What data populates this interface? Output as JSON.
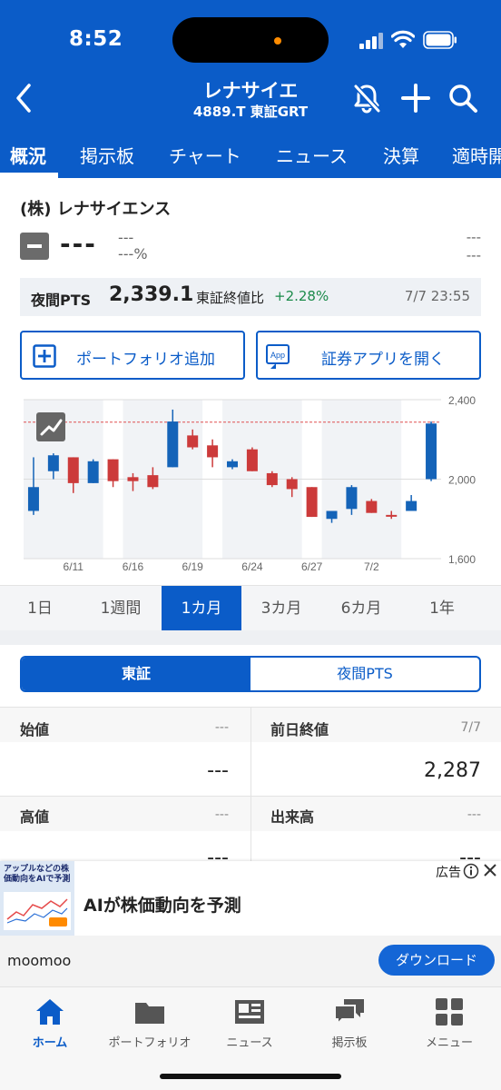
{
  "status_bar": {
    "time": "8:52"
  },
  "header": {
    "title": "レナサイエ",
    "subtitle": "4889.T 東証GRT",
    "icons": [
      "back-chevron-icon",
      "bell-off-icon",
      "plus-icon",
      "search-icon"
    ]
  },
  "tabs": [
    {
      "label": "概況",
      "active": true
    },
    {
      "label": "掲示板",
      "active": false
    },
    {
      "label": "チャート",
      "active": false
    },
    {
      "label": "ニュース",
      "active": false
    },
    {
      "label": "決算",
      "active": false
    },
    {
      "label": "適時開",
      "active": false
    }
  ],
  "stock": {
    "company": "(株) レナサイエンス",
    "price": "---",
    "change": "---",
    "change_pct": "---%",
    "right_top": "---",
    "right_bottom": "---"
  },
  "pts": {
    "label": "夜間PTS",
    "price": "2,339.1",
    "compare_label": "東証終値比",
    "change": "+2.28%",
    "time": "7/7 23:55"
  },
  "actions": {
    "portfolio_label": "ポートフォリオ追加",
    "app_label": "証券アプリを開く",
    "app_icon_text": "App"
  },
  "chart_data": {
    "type": "candlestick",
    "y_ticks": [
      "2,400",
      "2,000",
      "1,600"
    ],
    "ylim": [
      1600,
      2400
    ],
    "x_tick_labels": [
      "6/11",
      "6/16",
      "6/19",
      "6/24",
      "6/27",
      "7/2"
    ],
    "reference_line": 2287,
    "candles": [
      {
        "open": 1840,
        "close": 1960,
        "high": 2110,
        "low": 1820
      },
      {
        "open": 2040,
        "close": 2120,
        "high": 2130,
        "low": 2000
      },
      {
        "open": 2110,
        "close": 1980,
        "high": 2110,
        "low": 1930
      },
      {
        "open": 1980,
        "close": 2090,
        "high": 2100,
        "low": 1980
      },
      {
        "open": 2100,
        "close": 1990,
        "high": 2100,
        "low": 1960
      },
      {
        "open": 2010,
        "close": 1990,
        "high": 2030,
        "low": 1940
      },
      {
        "open": 2020,
        "close": 1960,
        "high": 2060,
        "low": 1950
      },
      {
        "open": 2060,
        "close": 2290,
        "high": 2350,
        "low": 2060
      },
      {
        "open": 2220,
        "close": 2160,
        "high": 2250,
        "low": 2150
      },
      {
        "open": 2170,
        "close": 2110,
        "high": 2200,
        "low": 2060
      },
      {
        "open": 2060,
        "close": 2090,
        "high": 2100,
        "low": 2050
      },
      {
        "open": 2150,
        "close": 2040,
        "high": 2160,
        "low": 2040
      },
      {
        "open": 2030,
        "close": 1970,
        "high": 2040,
        "low": 1960
      },
      {
        "open": 2000,
        "close": 1950,
        "high": 2010,
        "low": 1910
      },
      {
        "open": 1960,
        "close": 1810,
        "high": 1960,
        "low": 1810
      },
      {
        "open": 1800,
        "close": 1840,
        "high": 1840,
        "low": 1780
      },
      {
        "open": 1850,
        "close": 1960,
        "high": 1970,
        "low": 1820
      },
      {
        "open": 1890,
        "close": 1830,
        "high": 1900,
        "low": 1830
      },
      {
        "open": 1820,
        "close": 1815,
        "high": 1840,
        "low": 1800
      },
      {
        "open": 1840,
        "close": 1890,
        "high": 1920,
        "low": 1840
      },
      {
        "open": 2000,
        "close": 2280,
        "high": 2290,
        "low": 1990
      }
    ],
    "colors": {
      "up": "#1463b8",
      "down": "#cc3a3a",
      "ref": "#e05050"
    },
    "badge_icon": "trend-chart-icon"
  },
  "ranges": [
    {
      "label": "1日",
      "active": false
    },
    {
      "label": "1週間",
      "active": false
    },
    {
      "label": "1カ月",
      "active": true
    },
    {
      "label": "3カ月",
      "active": false
    },
    {
      "label": "6カ月",
      "active": false
    },
    {
      "label": "1年",
      "active": false
    }
  ],
  "market_toggle": {
    "primary": "東証",
    "secondary": "夜間PTS"
  },
  "data_grid": {
    "open_label": "始値",
    "open_meta": "---",
    "open_value": "---",
    "prev_close_label": "前日終値",
    "prev_close_meta": "7/7",
    "prev_close_value": "2,287",
    "high_label": "高値",
    "high_meta": "---",
    "high_value": "---",
    "volume_label": "出来高",
    "volume_meta": "---",
    "volume_value": "---"
  },
  "ad": {
    "image_text": "アップルなどの株価動向をAIで予測",
    "headline": "AIが株価動向を予測",
    "tag": "広告",
    "brand": "moomoo",
    "cta": "ダウンロード"
  },
  "bottom_nav": [
    {
      "label": "ホーム",
      "icon": "home-icon",
      "active": true
    },
    {
      "label": "ポートフォリオ",
      "icon": "folder-icon",
      "active": false
    },
    {
      "label": "ニュース",
      "icon": "newspaper-icon",
      "active": false
    },
    {
      "label": "掲示板",
      "icon": "chat-bubbles-icon",
      "active": false
    },
    {
      "label": "メニュー",
      "icon": "grid-menu-icon",
      "active": false
    }
  ]
}
